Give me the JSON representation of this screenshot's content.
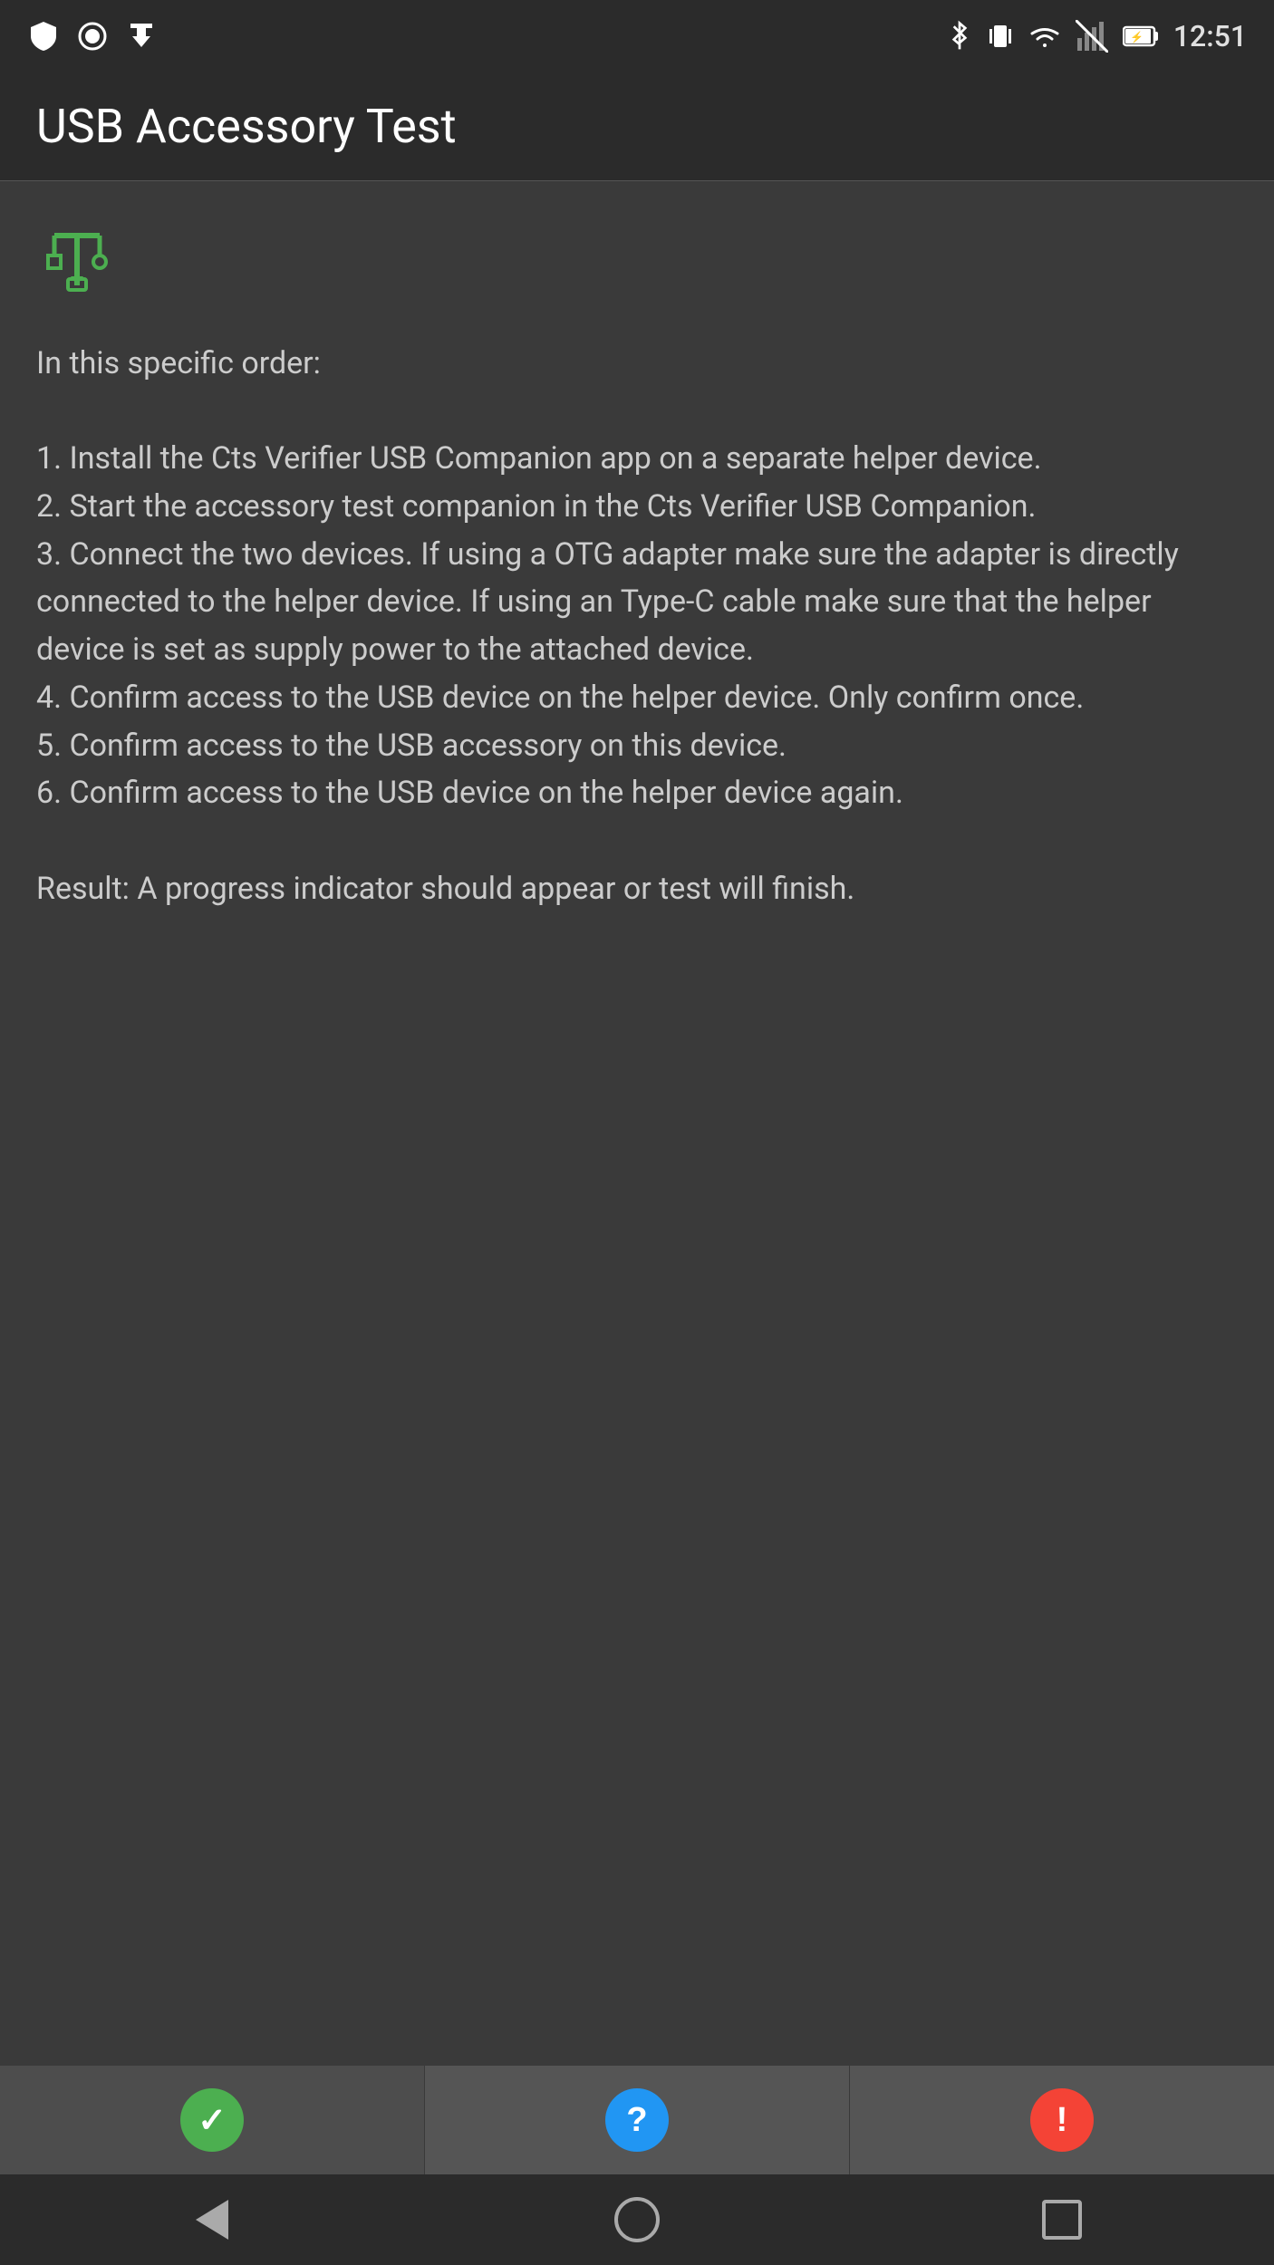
{
  "status_bar": {
    "time": "12:51",
    "icons_left": [
      "shield",
      "record",
      "download"
    ],
    "icons_right": [
      "bluetooth",
      "vibrate",
      "wifi",
      "signal",
      "battery"
    ]
  },
  "app_bar": {
    "title": "USB Accessory Test"
  },
  "usb_icon": {
    "symbol": "⌘",
    "label": "usb-symbol"
  },
  "instructions": {
    "intro": "In this specific order:",
    "steps": [
      "1. Install the Cts Verifier USB Companion app on a separate helper device.",
      "2. Start the accessory test companion in the Cts Verifier USB Companion.",
      "3. Connect the two devices. If using a OTG adapter make sure the adapter is directly connected to the helper device. If using an Type-C cable make sure that the helper device is set as supply power to the attached device.",
      "4. Confirm access to the USB device on the helper device. Only confirm once.",
      "5. Confirm access to the USB accessory on this device.",
      "6. Confirm access to the USB device on the helper device again."
    ],
    "result": "Result: A progress indicator should appear or test will finish."
  },
  "action_buttons": {
    "pass_label": "✓",
    "info_label": "?",
    "fail_label": "!"
  },
  "nav_bar": {
    "back_label": "back",
    "home_label": "home",
    "recents_label": "recents"
  }
}
